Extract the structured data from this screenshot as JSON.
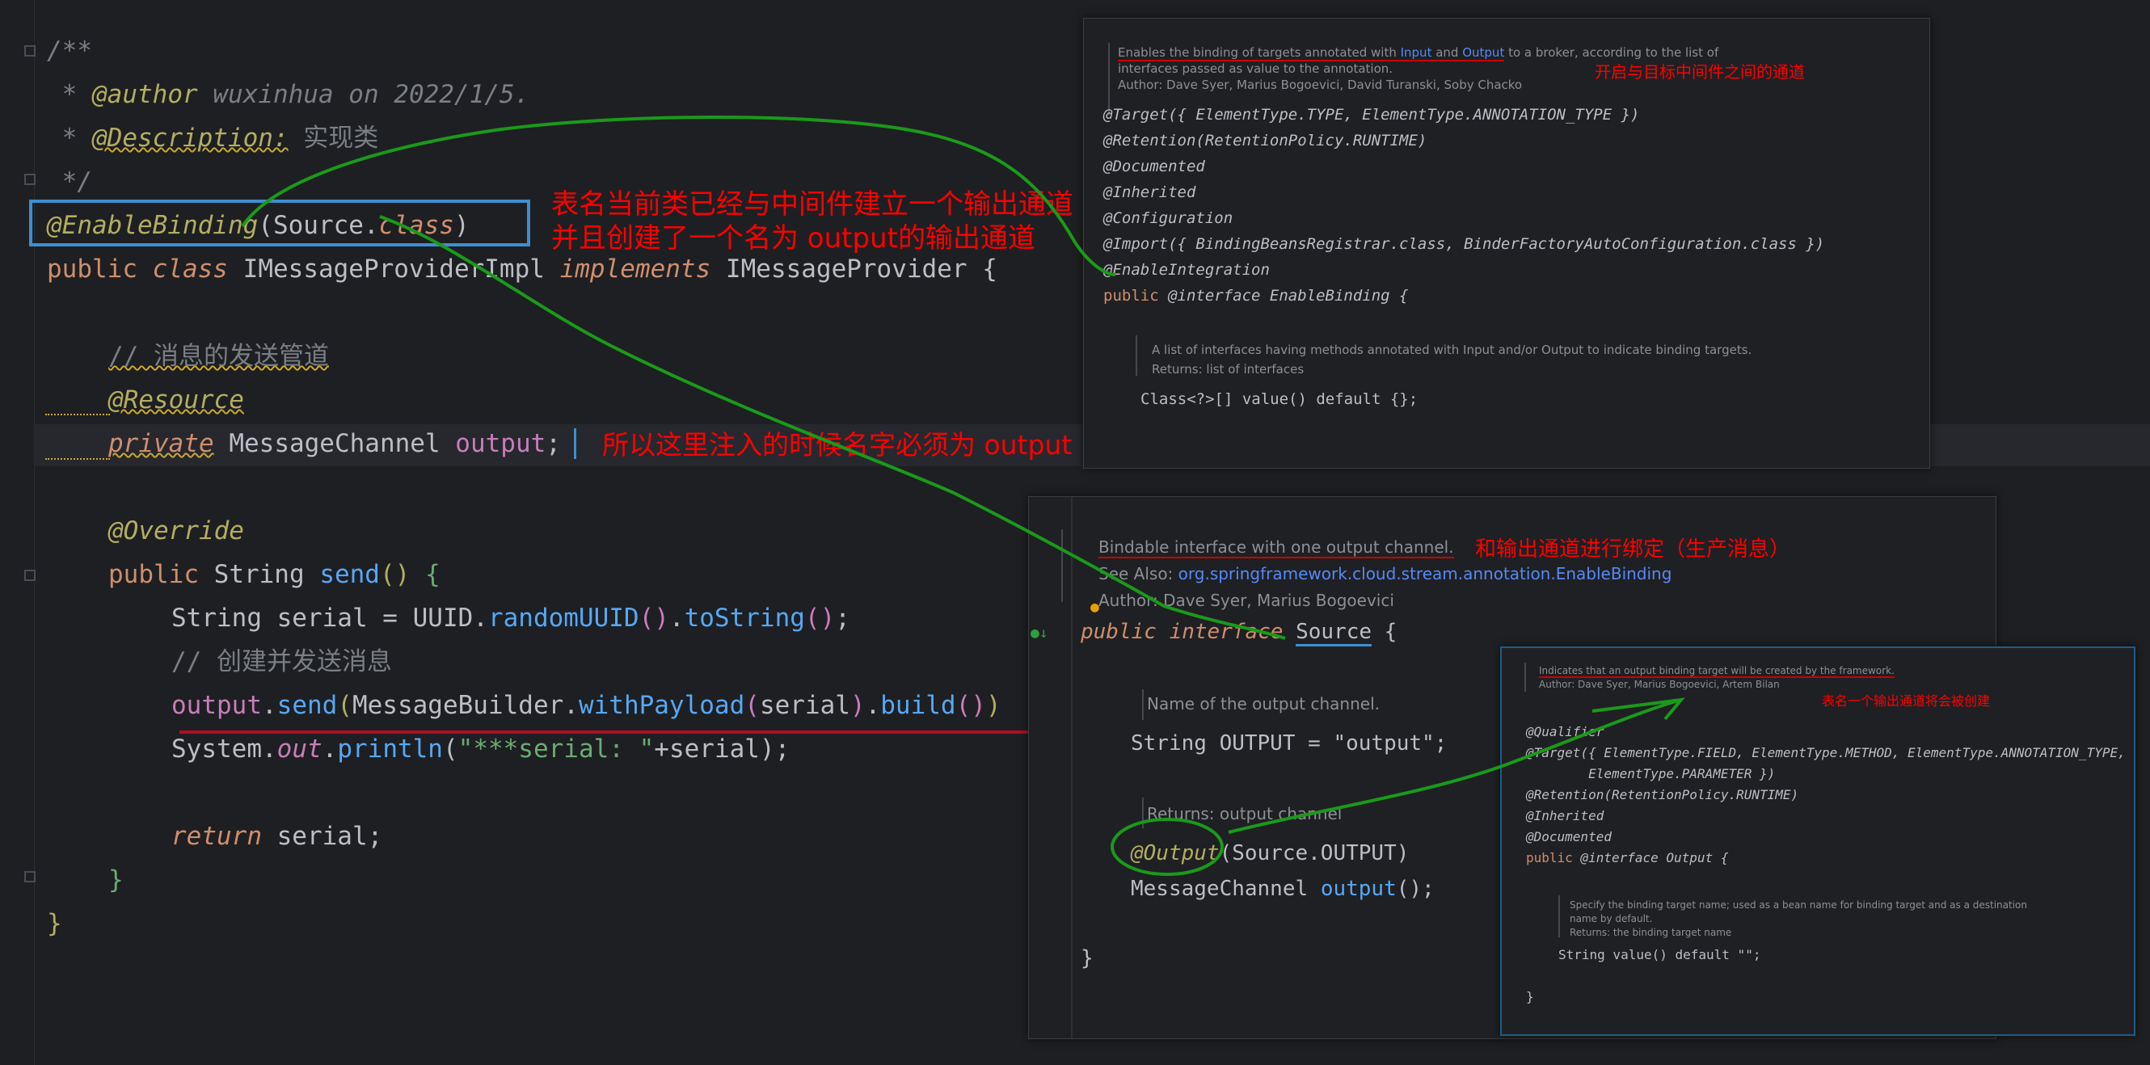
{
  "editor": {
    "comment": {
      "open": "/**",
      "star1": " * ",
      "author_tag": "@author",
      "author_text": " wuxinhua on 2022/1/5.",
      "star2": " * ",
      "desc_tag": "@Description:",
      "desc_text": " 实现类",
      "close": " */"
    },
    "annotation": "@EnableBinding",
    "annotation_arg_open": "(Source.",
    "annotation_arg_class": "class",
    "annotation_arg_close": ")",
    "class_decl": {
      "public": "public",
      "class": "class",
      "name": "IMessageProviderImpl",
      "implements": "implements",
      "iface": "IMessageProvider",
      "brace": "{"
    },
    "field_comment": "// 消息的发送管道",
    "resource_ann": "@Resource",
    "field_private": "private",
    "field_type": "MessageChannel",
    "field_name": "output",
    "field_semi": ";",
    "override_ann": "@Override",
    "method_public": "public",
    "method_type": "String",
    "method_name": "send",
    "method_parens": "()",
    "method_brace": "{",
    "line_serial_type": "String",
    "line_serial_var": " serial = ",
    "line_serial_uuid": "UUID",
    "line_serial_rand": "randomUUID",
    "line_serial_tostr": "toString",
    "comment_send": "// 创建并发送消息",
    "send_output": "output",
    "send_send": "send",
    "send_builder": "MessageBuilder",
    "send_withpayload": "withPayload",
    "send_serial": "serial",
    "send_build": "build",
    "print_system": "System",
    "print_out": "out",
    "print_println": "println",
    "print_str": "\"***serial: \"",
    "print_rest": "+serial);",
    "return_kw": "return",
    "return_rest": " serial;",
    "close_method": "}",
    "close_class": "}"
  },
  "annotations_red": {
    "note1_line1": "表名当前类已经与中间件建立一个输出通道",
    "note1_line2": "并且创建了一个名为 output的输出通道",
    "note2": "所以这里注入的时候名字必须为 output",
    "note3": "开启与目标中间件之间的通道",
    "note4": "和输出通道进行绑定（生产消息）",
    "note5": "表名一个输出通道将会被创建"
  },
  "popup_enablebinding": {
    "doc1": "Enables the binding of targets annotated with ",
    "doc1_input": "Input",
    "doc1_and": " and ",
    "doc1_output": "Output",
    "doc1_rest": " to a broker, according to the list of",
    "doc2": "interfaces passed as value to the annotation.",
    "doc3": "Author: Dave Syer, Marius Bogoevici, David Turanski, Soby Chacko",
    "l1": "@Target({ ElementType.TYPE, ElementType.ANNOTATION_TYPE })",
    "l2": "@Retention(RetentionPolicy.RUNTIME)",
    "l3": "@Documented",
    "l4": "@Inherited",
    "l5": "@Configuration",
    "l6": "@Import({ BindingBeansRegistrar.class, BinderFactoryAutoConfiguration.class })",
    "l7": "@EnableIntegration",
    "l8_public": "public",
    "l8_rest": " @interface EnableBinding {",
    "doc4": "A list of interfaces having methods annotated with Input and/or Output to indicate binding targets.",
    "doc5": "Returns: list of interfaces",
    "l9": "Class<?>[] value() default {};"
  },
  "popup_source": {
    "doc1": "Bindable interface with one output channel.",
    "doc2_label": "See Also: ",
    "doc2_link": "org.springframework.cloud.stream.annotation.EnableBinding",
    "doc3": "Author:    Dave Syer, Marius Bogoevici",
    "l1_public": "public",
    "l1_interface": " interface ",
    "l1_name": "Source",
    "l1_brace": " {",
    "doc4": "Name of the output channel.",
    "l2": "String OUTPUT = \"output\";",
    "doc5": "Returns: output channel",
    "l3_ann": "@Output",
    "l3_rest": "(Source.OUTPUT)",
    "l4_type": "MessageChannel ",
    "l4_method": "output",
    "l4_rest": "();",
    "l5": "}"
  },
  "popup_output": {
    "doc1": "Indicates that an output binding target will be created by the framework.",
    "doc2": "Author: Dave Syer, Marius Bogoevici, Artem Bilan",
    "l1": "@Qualifier",
    "l2": "@Target({ ElementType.FIELD, ElementType.METHOD, ElementType.ANNOTATION_TYPE,",
    "l3": "        ElementType.PARAMETER })",
    "l4": "@Retention(RetentionPolicy.RUNTIME)",
    "l5": "@Inherited",
    "l6": "@Documented",
    "l7_public": "public",
    "l7_rest": " @interface Output {",
    "doc3": "Specify the binding target name; used as a bean name for binding target and as a destination",
    "doc4": "name by default.",
    "doc5": "Returns: the binding target name",
    "l8": "String value() default \"\";",
    "l9": "}"
  },
  "colors": {
    "background": "#1e1f22",
    "annotation_red": "#ff0000",
    "arrow_green": "#1a9a1a",
    "highlight_box": "#3d8fd1"
  }
}
